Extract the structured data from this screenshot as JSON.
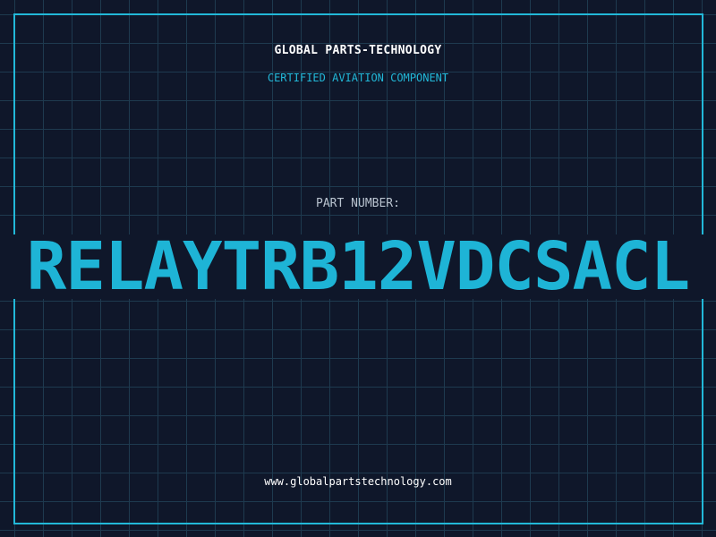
{
  "label": {
    "company": "GLOBAL PARTS-TECHNOLOGY",
    "tagline": "CERTIFIED AVIATION COMPONENT",
    "part_number_label": "PART NUMBER:",
    "part_number": "RELAYTRB12VDCSACL",
    "website": "www.globalpartstechnology.com"
  },
  "colors": {
    "background": "#0f172a",
    "grid": "#1e3a4f",
    "accent": "#22b8d8",
    "text": "#ffffff"
  }
}
